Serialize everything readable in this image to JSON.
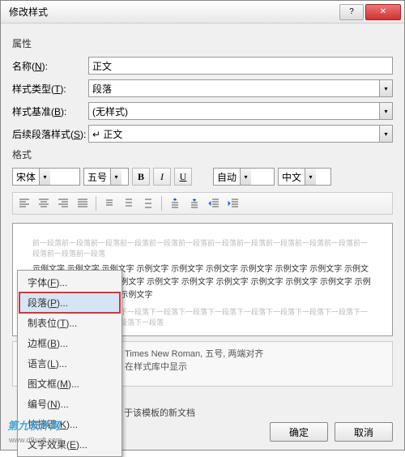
{
  "title": "修改样式",
  "sections": {
    "properties": "属性",
    "format": "格式"
  },
  "labels": {
    "name": "名称(N):",
    "styleType": "样式类型(T):",
    "styleBase": "样式基准(B):",
    "followStyle": "后续段落样式(S):"
  },
  "values": {
    "name": "正文",
    "styleType": "段落",
    "styleBase": "(无样式)",
    "followStyle": "↵ 正文"
  },
  "formatRow": {
    "font": "宋体",
    "size": "五号",
    "auto": "自动",
    "lang": "中文"
  },
  "preview": {
    "grayBefore": "前一段落前一段落前一段落前一段落前一段落前一段落前一段落前一段落前一段落前一段落前一段落前一段落前一段落前一段落",
    "main": "示例文字 示例文字 示例文字 示例文字 示例文字 示例文字 示例文字 示例文字 示例文字 示例文字 示例文字 示例文字 示例文字 示例文字 示例文字 示例文字 示例文字 示例文字 示例文字 示例文字 示例文字 示例文字 示例文字",
    "grayAfter": "下一段落下一段落下一段落下一段落下一段落下一段落下一段落下一段落下一段落下一段落下一段落下一段落下一段落下一段落下一段落下一段落"
  },
  "desc": {
    "line1": "Times New Roman, 五号, 两端对齐",
    "line2": "在样式库中显示"
  },
  "bottomLine": "于该模板的新文档",
  "buttons": {
    "ok": "确定",
    "cancel": "取消"
  },
  "menu": {
    "font": "字体(F)...",
    "paragraph": "段落(P)...",
    "tabs": "制表位(T)...",
    "border": "边框(B)...",
    "language": "语言(L)...",
    "frame": "图文框(M)...",
    "numbering": "编号(N)...",
    "shortcut": "快捷键(K)...",
    "textEffects": "文字效果(E)..."
  },
  "watermark": {
    "main": "第九软件网",
    "sub": "www.d9soft.com"
  }
}
